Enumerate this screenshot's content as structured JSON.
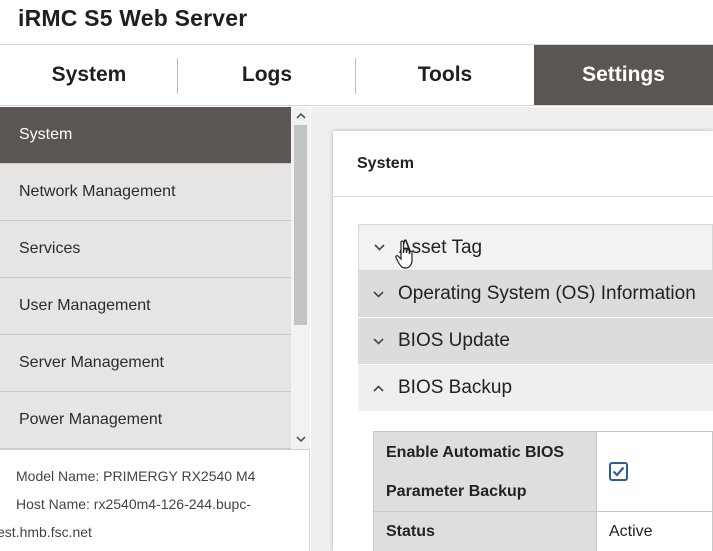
{
  "app": {
    "title": "iRMC S5 Web Server"
  },
  "top_nav": {
    "tabs": [
      {
        "label": "System"
      },
      {
        "label": "Logs"
      },
      {
        "label": "Tools"
      },
      {
        "label": "Settings"
      }
    ],
    "active": "Settings"
  },
  "sidebar": {
    "items": [
      {
        "label": "System"
      },
      {
        "label": "Network Management"
      },
      {
        "label": "Services"
      },
      {
        "label": "User Management"
      },
      {
        "label": "Server Management"
      },
      {
        "label": "Power Management"
      }
    ],
    "active": "System",
    "scroll_up_icon": "chevron-up-icon",
    "scroll_down_icon": "chevron-down-icon"
  },
  "model_info": {
    "model_name": "Model Name: PRIMERGY RX2540 M4",
    "host_name_line1": "Host Name: rx2540m4-126-244.bupc-",
    "host_name_line2": "est.hmb.fsc.net"
  },
  "panel": {
    "title": "System",
    "accordion": [
      {
        "label": "Asset Tag",
        "state": "collapsed"
      },
      {
        "label": "Operating System (OS) Information",
        "state": "collapsed"
      },
      {
        "label": "BIOS Update",
        "state": "collapsed"
      },
      {
        "label": "BIOS Backup",
        "state": "expanded"
      }
    ],
    "bios_backup": {
      "enable_label_line1": "Enable Automatic BIOS",
      "enable_label_line2": "Parameter Backup",
      "enable_checked": true,
      "status_label": "Status",
      "status_value": "Active"
    }
  },
  "colors": {
    "accent_dark": "#5c5652",
    "sidebar_bg": "#e6e5e4",
    "checkbox": "#2a5f9e"
  }
}
